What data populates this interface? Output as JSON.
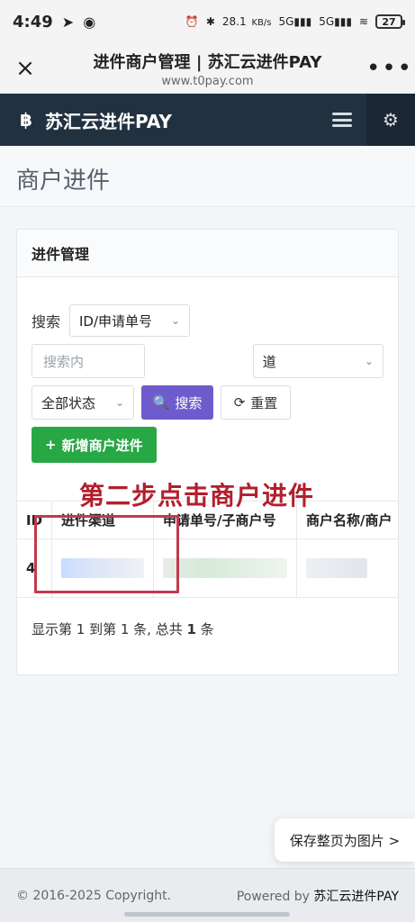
{
  "status_bar": {
    "time": "4:49",
    "network_speed_value": "28.1",
    "network_speed_unit": "KB/s",
    "signal_1_label": "5G",
    "signal_2_label": "5G",
    "battery_text": "27"
  },
  "browser": {
    "close_label": "×",
    "title": "进件商户管理 | 苏汇云进件PAY",
    "url": "www.t0pay.com",
    "more_label": "•••"
  },
  "app": {
    "brand_title": "苏汇云进件PAY",
    "brand_symbol": "฿"
  },
  "page": {
    "heading": "商户进件"
  },
  "card": {
    "header": "进件管理",
    "search_label": "搜索",
    "search_field_value": "ID/申请单号",
    "search_input_placeholder": "搜索内",
    "channel_select_value": "道",
    "status_select_value": "全部状态",
    "search_button_label": "搜索",
    "reset_button_label": "重置",
    "add_button_label": "新增商户进件"
  },
  "table": {
    "headers": [
      "ID",
      "进件渠道",
      "申请单号/子商户号",
      "商户名称/商户"
    ],
    "rows": [
      {
        "id": "4"
      }
    ]
  },
  "pagination": {
    "text_prefix": "显示第 1 到第 1 条, 总共 ",
    "total": "1",
    "text_suffix": " 条"
  },
  "overlay": {
    "step_text": "第二步点击商户进件"
  },
  "tooltip": {
    "save_text": "保存整页为图片 >"
  },
  "footer": {
    "left": "© 2016-2025 Copyright.",
    "right_prefix": "Powered by ",
    "right_brand": "苏汇云进件PAY"
  },
  "colors": {
    "nav_dark": "#22313f",
    "accent_green": "#28a745",
    "purple": "#6f5ccc",
    "annotation_red": "#b21f2d"
  },
  "icons": {
    "close": "close-icon",
    "more": "more-icon",
    "menu": "hamburger-menu-icon",
    "settings": "gear-icon",
    "search": "search-icon",
    "refresh": "refresh-icon",
    "add": "plus-icon"
  }
}
